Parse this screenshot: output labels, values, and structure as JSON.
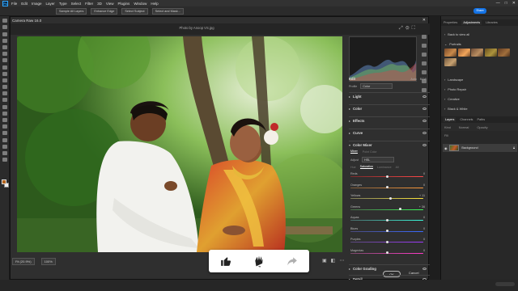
{
  "app": {
    "menu": [
      "File",
      "Edit",
      "Image",
      "Layer",
      "Type",
      "Select",
      "Filter",
      "3D",
      "View",
      "Plugins",
      "Window",
      "Help"
    ],
    "logo": "Ps",
    "window_controls": [
      "—",
      "□",
      "✕"
    ]
  },
  "options_bar": {
    "items": [
      "Sample All Layers",
      "Enhance Edge",
      "Select Subject",
      "Select and Mask..."
    ],
    "share": "Share"
  },
  "camera_raw": {
    "title": "Camera Raw 16.0",
    "close": "✕",
    "photo_title": "Photo by Anoop VS.jpg",
    "zoom": "Fit (20.9%)",
    "zoom_pct": "100%",
    "buttons": {
      "ok": "OK",
      "cancel": "Cancel"
    },
    "edit": {
      "heading": "Edit",
      "auto": "Auto",
      "bw": "B&W",
      "profile_label": "Profile",
      "profile_value": "Color",
      "sections_collapsed": [
        "Light",
        "Color",
        "Effects",
        "Curve"
      ],
      "color_mixer": {
        "title": "Color Mixer",
        "tabs": [
          "Mixer",
          "Point Color"
        ],
        "adjust_label": "Adjust",
        "adjust_value": "HSL",
        "subtabs": [
          "Hue",
          "Saturation",
          "Luminance",
          "All"
        ],
        "sliders": [
          {
            "label": "Reds",
            "value": "0",
            "pos": 0.5,
            "colors": [
              "#7a2a2a",
              "#ff4848"
            ]
          },
          {
            "label": "Oranges",
            "value": "0",
            "pos": 0.5,
            "colors": [
              "#7a5a3a",
              "#ff9a3a"
            ]
          },
          {
            "label": "Yellows",
            "value": "+ 11",
            "pos": 0.555,
            "colors": [
              "#7a7a5a",
              "#ffe83a"
            ]
          },
          {
            "label": "Greens",
            "value": "+ 36",
            "pos": 0.68,
            "colors": [
              "#4a6a4a",
              "#3aff5a"
            ]
          },
          {
            "label": "Aquas",
            "value": "0",
            "pos": 0.5,
            "colors": [
              "#4a6a6a",
              "#3affe0"
            ]
          },
          {
            "label": "Blues",
            "value": "0",
            "pos": 0.5,
            "colors": [
              "#4a4a7a",
              "#3a6aff"
            ]
          },
          {
            "label": "Purples",
            "value": "0",
            "pos": 0.5,
            "colors": [
              "#5a4a7a",
              "#a03aff"
            ]
          },
          {
            "label": "Magentas",
            "value": "0",
            "pos": 0.5,
            "colors": [
              "#7a4a6a",
              "#ff3ac8"
            ]
          }
        ]
      },
      "sections_bottom": [
        "Color Grading",
        "Detail"
      ]
    }
  },
  "ps_panels": {
    "tabs_top": [
      "Properties",
      "Adjustments",
      "Libraries"
    ],
    "back": "Back to view all",
    "portraits": "Portraits",
    "adjust_items": [
      "Landscape",
      "Photo Repair",
      "Creative",
      "Black & White"
    ],
    "layer_tabs": [
      "Layers",
      "Channels",
      "Paths"
    ],
    "kind": "Kind",
    "normal": "Normal",
    "opacity": "Opacity",
    "fill": "Fill",
    "layer_name": "Background"
  },
  "reactions": [
    "thumbs-up",
    "clap",
    "share"
  ]
}
